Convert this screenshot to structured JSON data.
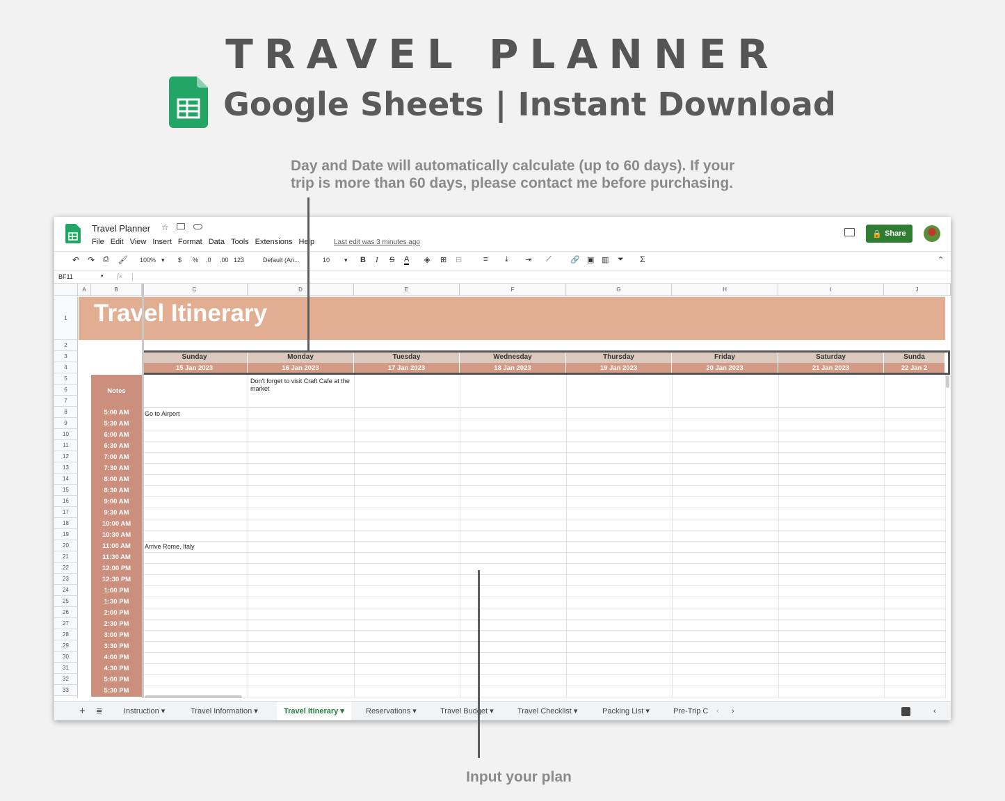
{
  "heading": "TRAVEL PLANNER",
  "subheading": "Google Sheets | Instant Download",
  "callout_top_line1": "Day and Date will automatically calculate (up to 60 days). If your",
  "callout_top_line2": "trip is more than 60 days, please contact me before purchasing.",
  "callout_bottom": "Input your plan",
  "sheet": {
    "doc_title": "Travel Planner",
    "menu": [
      "File",
      "Edit",
      "View",
      "Insert",
      "Format",
      "Data",
      "Tools",
      "Extensions",
      "Help"
    ],
    "last_edit": "Last edit was 3 minutes ago",
    "share_label": "Share",
    "zoom": "100%",
    "font_family": "Default (Ari...",
    "font_size": "10",
    "number_format": "123",
    "cell_ref": "BF11",
    "fx": "fx",
    "columns": [
      "A",
      "B",
      "C",
      "D",
      "E",
      "F",
      "G",
      "H",
      "I",
      "J"
    ],
    "banner_title": "Travel Itinerary",
    "days": [
      {
        "day": "Sunday",
        "date": "15 Jan 2023"
      },
      {
        "day": "Monday",
        "date": "16 Jan 2023"
      },
      {
        "day": "Tuesday",
        "date": "17 Jan 2023"
      },
      {
        "day": "Wednesday",
        "date": "18 Jan 2023"
      },
      {
        "day": "Thursday",
        "date": "19 Jan 2023"
      },
      {
        "day": "Friday",
        "date": "20 Jan 2023"
      },
      {
        "day": "Saturday",
        "date": "21 Jan 2023"
      },
      {
        "day": "Sunda",
        "date": "22 Jan 2"
      }
    ],
    "notes_label": "Notes",
    "note_monday": "Don't forget to visit Craft Cafe at the market",
    "times": [
      "5:00 AM",
      "5:30 AM",
      "6:00 AM",
      "6:30 AM",
      "7:00 AM",
      "7:30 AM",
      "8:00 AM",
      "8:30 AM",
      "9:00 AM",
      "9:30 AM",
      "10:00 AM",
      "10:30 AM",
      "11:00 AM",
      "11:30 AM",
      "12:00 PM",
      "12:30 PM",
      "1:00 PM",
      "1:30 PM",
      "2:00 PM",
      "2:30 PM",
      "3:00 PM",
      "3:30 PM",
      "4:00 PM",
      "4:30 PM",
      "5:00 PM",
      "5:30 PM"
    ],
    "entry_go_airport": "Go to Airport",
    "entry_arrive_rome": "Arrive Rome, Italy",
    "tabs": [
      "Instruction",
      "Travel Information",
      "Travel Itinerary",
      "Reservations",
      "Travel Budget",
      "Travel Checklist",
      "Packing List",
      "Pre-Trip C"
    ],
    "active_tab": "Travel Itinerary"
  },
  "colors": {
    "banner": "#e2ae92",
    "time_col": "#cc8f7e",
    "day_hdr": "#dbc8be",
    "date_hdr": "#d39a85",
    "share": "#2e7d32"
  }
}
